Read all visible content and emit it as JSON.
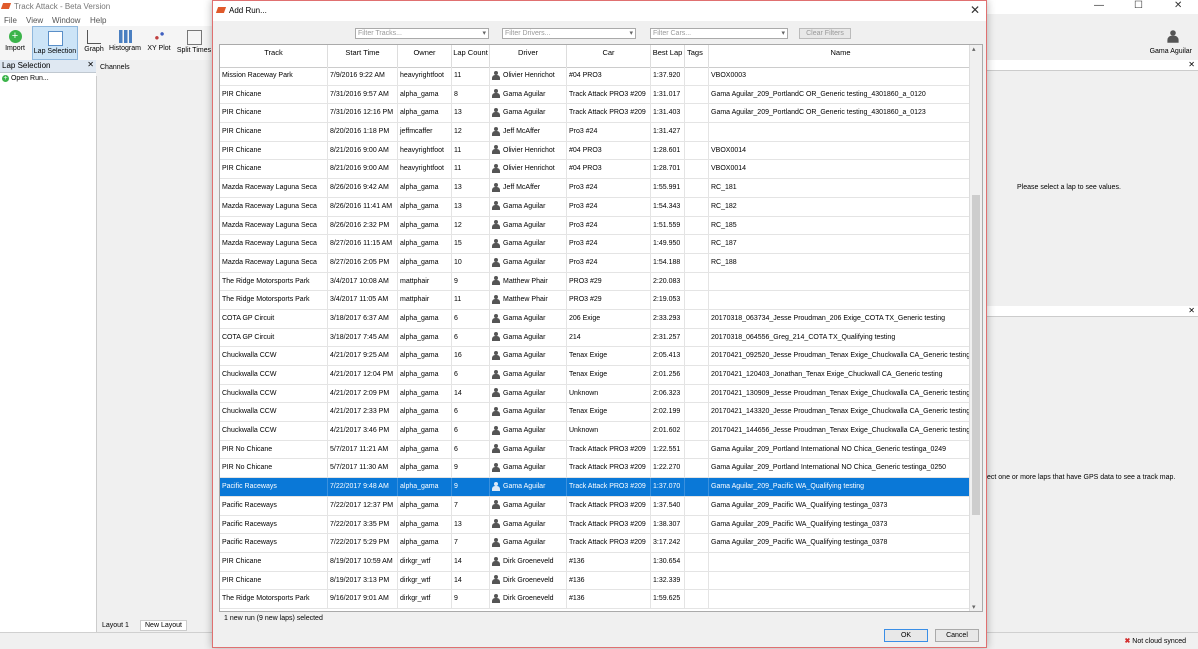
{
  "app": {
    "title": "Track Attack - Beta Version",
    "menu": [
      "File",
      "View",
      "Window",
      "Help"
    ],
    "toolbar": [
      "Import",
      "Lap Selection",
      "Graph",
      "Histogram",
      "XY Plot",
      "Split Times"
    ],
    "user": "Gama Aguilar",
    "left_panel_title": "Lap Selection",
    "open_run": "Open Run...",
    "channels": "Channels",
    "right_top_msg": "Please select a lap to see values.",
    "right_bot_msg": "ect one or more laps that have GPS data to see a track map.",
    "tabs": [
      "Layout 1",
      "New Layout"
    ],
    "status": "Not cloud synced",
    "accent": "#e05a2b"
  },
  "dialog": {
    "title": "Add Run...",
    "filters": {
      "tracks": "Filter Tracks...",
      "drivers": "Filter Drivers...",
      "cars": "Filter Cars...",
      "clear": "Clear Filters"
    },
    "columns": [
      "Track",
      "Start Time",
      "Owner",
      "Lap Count",
      "Driver",
      "Car",
      "Best Lap",
      "Tags",
      "Name"
    ],
    "rows": [
      [
        "Mission Raceway Park",
        "7/9/2016 9:22 AM",
        "heavyrightfoot",
        "11",
        "Olivier Henrichot",
        "#04 PRO3",
        "1:37.920",
        "",
        "VBOX0003"
      ],
      [
        "PIR Chicane",
        "7/31/2016 9:57 AM",
        "alpha_gama",
        "8",
        "Gama Aguilar",
        "Track Attack PRO3 #209",
        "1:31.017",
        "",
        "Gama Aguilar_209_PortlandC OR_Generic testing_4301860_a_0120"
      ],
      [
        "PIR Chicane",
        "7/31/2016 12:16 PM",
        "alpha_gama",
        "13",
        "Gama Aguilar",
        "Track Attack PRO3 #209",
        "1:31.403",
        "",
        "Gama Aguilar_209_PortlandC OR_Generic testing_4301860_a_0123"
      ],
      [
        "PIR Chicane",
        "8/20/2016 1:18 PM",
        "jeffmcaffer",
        "12",
        "Jeff McAffer",
        "Pro3 #24",
        "1:31.427",
        "",
        ""
      ],
      [
        "PIR Chicane",
        "8/21/2016 9:00 AM",
        "heavyrightfoot",
        "11",
        "Olivier Henrichot",
        "#04 PRO3",
        "1:28.601",
        "",
        "VBOX0014"
      ],
      [
        "PIR Chicane",
        "8/21/2016 9:00 AM",
        "heavyrightfoot",
        "11",
        "Olivier Henrichot",
        "#04 PRO3",
        "1:28.701",
        "",
        "VBOX0014"
      ],
      [
        "Mazda Raceway Laguna Seca",
        "8/26/2016 9:42 AM",
        "alpha_gama",
        "13",
        "Jeff McAffer",
        "Pro3 #24",
        "1:55.991",
        "",
        "RC_181"
      ],
      [
        "Mazda Raceway Laguna Seca",
        "8/26/2016 11:41 AM",
        "alpha_gama",
        "13",
        "Gama Aguilar",
        "Pro3 #24",
        "1:54.343",
        "",
        "RC_182"
      ],
      [
        "Mazda Raceway Laguna Seca",
        "8/26/2016 2:32 PM",
        "alpha_gama",
        "12",
        "Gama Aguilar",
        "Pro3 #24",
        "1:51.559",
        "",
        "RC_185"
      ],
      [
        "Mazda Raceway Laguna Seca",
        "8/27/2016 11:15 AM",
        "alpha_gama",
        "15",
        "Gama Aguilar",
        "Pro3 #24",
        "1:49.950",
        "",
        "RC_187"
      ],
      [
        "Mazda Raceway Laguna Seca",
        "8/27/2016 2:05 PM",
        "alpha_gama",
        "10",
        "Gama Aguilar",
        "Pro3 #24",
        "1:54.188",
        "",
        "RC_188"
      ],
      [
        "The Ridge Motorsports Park",
        "3/4/2017 10:08 AM",
        "mattphair",
        "9",
        "Matthew Phair",
        "PRO3 #29",
        "2:20.083",
        "",
        ""
      ],
      [
        "The Ridge Motorsports Park",
        "3/4/2017 11:05 AM",
        "mattphair",
        "11",
        "Matthew Phair",
        "PRO3 #29",
        "2:19.053",
        "",
        ""
      ],
      [
        "COTA GP Circuit",
        "3/18/2017 6:37 AM",
        "alpha_gama",
        "6",
        "Gama Aguilar",
        "206 Exige",
        "2:33.293",
        "",
        "20170318_063734_Jesse Proudman_206 Exige_COTA TX_Generic testing"
      ],
      [
        "COTA GP Circuit",
        "3/18/2017 7:45 AM",
        "alpha_gama",
        "6",
        "Gama Aguilar",
        "214",
        "2:31.257",
        "",
        "20170318_064556_Greg_214_COTA TX_Qualifying testing"
      ],
      [
        "Chuckwalla CCW",
        "4/21/2017 9:25 AM",
        "alpha_gama",
        "16",
        "Gama Aguilar",
        "Tenax Exige",
        "2:05.413",
        "",
        "20170421_092520_Jesse Proudman_Tenax Exige_Chuckwalla CA_Generic testing"
      ],
      [
        "Chuckwalla CCW",
        "4/21/2017 12:04 PM",
        "alpha_gama",
        "6",
        "Gama Aguilar",
        "Tenax Exige",
        "2:01.256",
        "",
        "20170421_120403_Jonathan_Tenax Exige_Chuckwall CA_Generic testing"
      ],
      [
        "Chuckwalla CCW",
        "4/21/2017 2:09 PM",
        "alpha_gama",
        "14",
        "Gama Aguilar",
        "Unknown",
        "2:06.323",
        "",
        "20170421_130909_Jesse Proudman_Tenax Exige_Chuckwalla CA_Generic testing"
      ],
      [
        "Chuckwalla CCW",
        "4/21/2017 2:33 PM",
        "alpha_gama",
        "6",
        "Gama Aguilar",
        "Tenax Exige",
        "2:02.199",
        "",
        "20170421_143320_Jesse Proudman_Tenax Exige_Chuckwalla CA_Generic testing"
      ],
      [
        "Chuckwalla CCW",
        "4/21/2017 3:46 PM",
        "alpha_gama",
        "6",
        "Gama Aguilar",
        "Unknown",
        "2:01.602",
        "",
        "20170421_144656_Jesse Proudman_Tenax Exige_Chuckwalla CA_Generic testing"
      ],
      [
        "PIR No Chicane",
        "5/7/2017 11:21 AM",
        "alpha_gama",
        "6",
        "Gama Aguilar",
        "Track Attack PRO3 #209",
        "1:22.551",
        "",
        "Gama Aguilar_209_Portland International NO Chica_Generic testinga_0249"
      ],
      [
        "PIR No Chicane",
        "5/7/2017 11:30 AM",
        "alpha_gama",
        "9",
        "Gama Aguilar",
        "Track Attack PRO3 #209",
        "1:22.270",
        "",
        "Gama Aguilar_209_Portland International NO Chica_Generic testinga_0250"
      ],
      [
        "Pacific Raceways",
        "7/22/2017 9:48 AM",
        "alpha_gama",
        "9",
        "Gama Aguilar",
        "Track Attack PRO3 #209",
        "1:37.070",
        "",
        "Gama Aguilar_209_Pacific WA_Qualifying testing"
      ],
      [
        "Pacific Raceways",
        "7/22/2017 12:37 PM",
        "alpha_gama",
        "7",
        "Gama Aguilar",
        "Track Attack PRO3 #209",
        "1:37.540",
        "",
        "Gama Aguilar_209_Pacific WA_Qualifying testinga_0373"
      ],
      [
        "Pacific Raceways",
        "7/22/2017 3:35 PM",
        "alpha_gama",
        "13",
        "Gama Aguilar",
        "Track Attack PRO3 #209",
        "1:38.307",
        "",
        "Gama Aguilar_209_Pacific WA_Qualifying testinga_0373"
      ],
      [
        "Pacific Raceways",
        "7/22/2017 5:29 PM",
        "alpha_gama",
        "7",
        "Gama Aguilar",
        "Track Attack PRO3 #209",
        "3:17.242",
        "",
        "Gama Aguilar_209_Pacific WA_Qualifying testinga_0378"
      ],
      [
        "PIR Chicane",
        "8/19/2017 10:59 AM",
        "dirkgr_wtf",
        "14",
        "Dirk Groeneveld",
        "#136",
        "1:30.654",
        "",
        ""
      ],
      [
        "PIR Chicane",
        "8/19/2017 3:13 PM",
        "dirkgr_wtf",
        "14",
        "Dirk Groeneveld",
        "#136",
        "1:32.339",
        "",
        ""
      ],
      [
        "The Ridge Motorsports Park",
        "9/16/2017 9:01 AM",
        "dirkgr_wtf",
        "9",
        "Dirk Groeneveld",
        "#136",
        "1:59.625",
        "",
        ""
      ]
    ],
    "selected_row": 22,
    "summary": "1 new run (9 new laps) selected",
    "ok": "OK",
    "cancel": "Cancel"
  }
}
